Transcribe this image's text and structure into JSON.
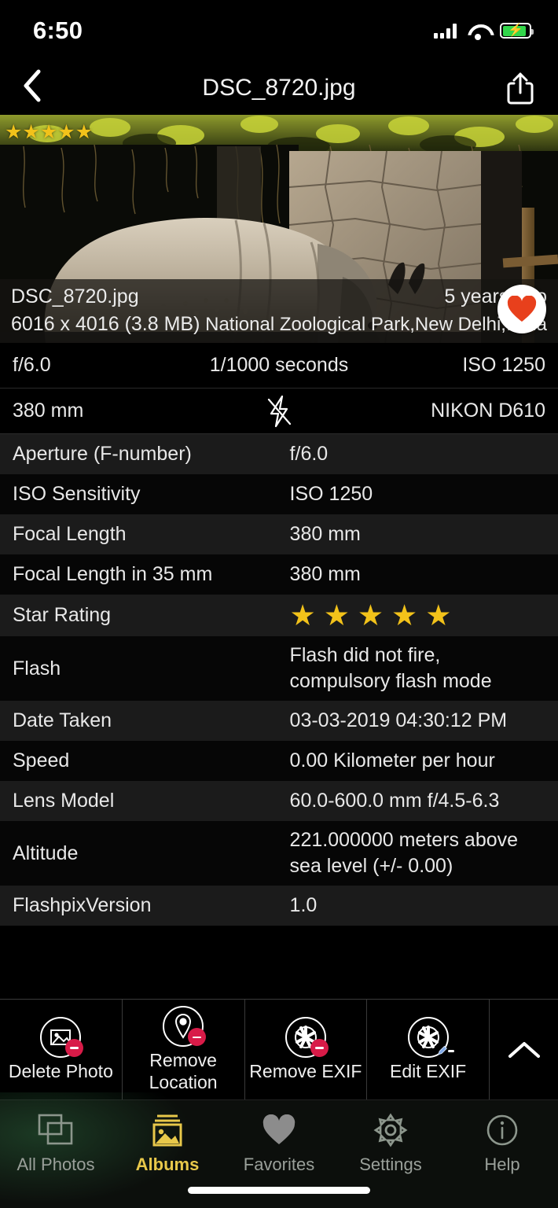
{
  "statusbar": {
    "time": "6:50",
    "signal_icon": "cellular-signal-icon",
    "wifi_icon": "wifi-icon",
    "battery_icon": "battery-charging-icon"
  },
  "navbar": {
    "back_icon": "chevron-left-icon",
    "title": "DSC_8720.jpg",
    "share_icon": "share-icon"
  },
  "photo": {
    "star_rating_overlay": "★★★★★",
    "favorite_icon": "heart-icon",
    "favorite_color": "#E8401C"
  },
  "overlay_info": {
    "filename": "DSC_8720.jpg",
    "age": "5 years ago",
    "dimensions": "6016 x 4016 (3.8 MB)",
    "location": "National Zoological Park,New Delhi,India"
  },
  "summary": {
    "aperture": "f/6.0",
    "shutter": "1/1000 seconds",
    "iso": "ISO 1250",
    "focal": "380 mm",
    "flash_icon": "flash-off-icon",
    "camera": "NIKON D610"
  },
  "exif_rows": [
    {
      "key": "Aperture (F-number)",
      "value": "f/6.0"
    },
    {
      "key": "ISO Sensitivity",
      "value": "ISO 1250"
    },
    {
      "key": "Focal Length",
      "value": "380 mm"
    },
    {
      "key": "Focal Length in 35 mm",
      "value": "380 mm"
    },
    {
      "key": "Star Rating",
      "value": "★★★★★"
    },
    {
      "key": "Flash",
      "value": "Flash did not fire, compulsory flash mode"
    },
    {
      "key": "Date Taken",
      "value": "03-03-2019 04:30:12 PM"
    },
    {
      "key": "Speed",
      "value": "0.00 Kilometer per hour"
    },
    {
      "key": "Lens Model",
      "value": "60.0-600.0 mm f/4.5-6.3"
    },
    {
      "key": "Altitude",
      "value": "221.000000 meters above sea level (+/- 0.00)"
    },
    {
      "key": "FlashpixVersion",
      "value": "1.0"
    }
  ],
  "actions": [
    {
      "label": "Delete Photo",
      "icon": "photo-remove-icon"
    },
    {
      "label": "Remove Location",
      "icon": "location-remove-icon"
    },
    {
      "label": "Remove EXIF",
      "icon": "aperture-remove-icon"
    },
    {
      "label": "Edit EXIF",
      "icon": "aperture-edit-icon"
    }
  ],
  "expand_icon": "chevron-up-icon",
  "tabs": [
    {
      "label": "All Photos",
      "icon": "photos-stack-icon",
      "active": false
    },
    {
      "label": "Albums",
      "icon": "albums-icon",
      "active": true
    },
    {
      "label": "Favorites",
      "icon": "heart-icon",
      "active": false
    },
    {
      "label": "Settings",
      "icon": "gear-icon",
      "active": false
    },
    {
      "label": "Help",
      "icon": "info-icon",
      "active": false
    }
  ],
  "colors": {
    "accent_yellow": "#E8C84A",
    "star_yellow": "#F2C21A",
    "badge_red": "#D81B48",
    "battery_green": "#32D74B"
  }
}
